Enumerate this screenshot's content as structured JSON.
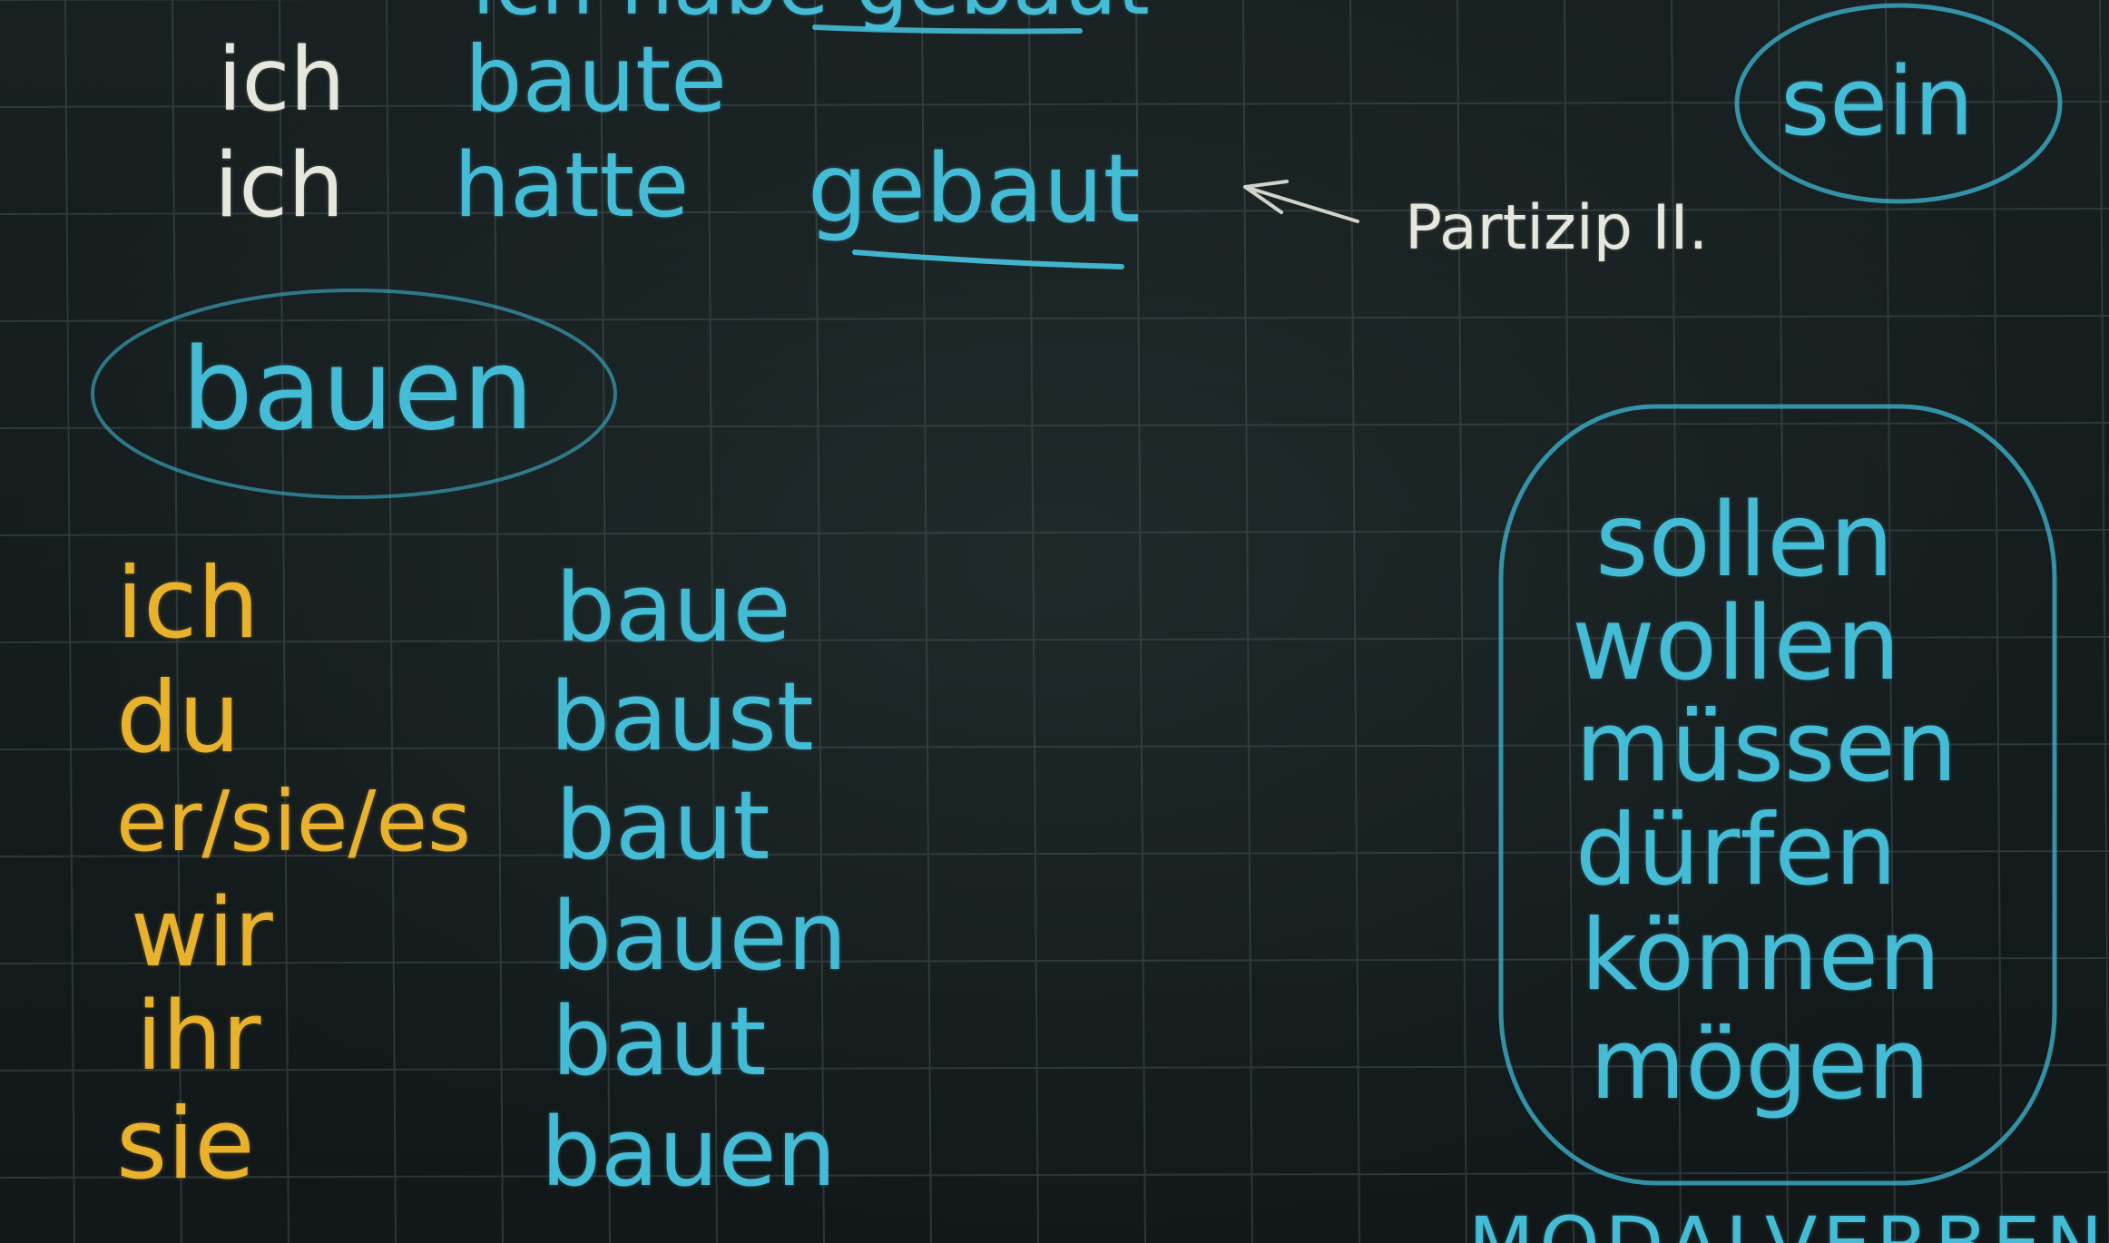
{
  "board": {
    "top_partial": "ich habe gebaut",
    "praeteritum": {
      "pronoun": "ich",
      "verb": "baute"
    },
    "plusquamperfekt": {
      "pronoun": "ich",
      "aux": "hatte",
      "participle": "gebaut"
    },
    "partizip_label": "Partizip II.",
    "sein": "sein",
    "infinitive": "bauen",
    "conjugation": [
      {
        "pronoun": "ich",
        "form": "baue"
      },
      {
        "pronoun": "du",
        "form": "baust"
      },
      {
        "pronoun": "er/sie/es",
        "form": "baut"
      },
      {
        "pronoun": "wir",
        "form": "bauen"
      },
      {
        "pronoun": "ihr",
        "form": "baut"
      },
      {
        "pronoun": "sie",
        "form": "bauen"
      }
    ],
    "modal_verbs": [
      "sollen",
      "wollen",
      "müssen",
      "dürfen",
      "können",
      "mögen"
    ],
    "bottom_partial": "MODALVERBEN",
    "colors": {
      "background": "#141a1b",
      "grid": "#4d5a5a",
      "chalk_white": "#e6e8de",
      "chalk_blue": "#45bcd6",
      "chalk_yellow": "#e8b22d"
    }
  }
}
